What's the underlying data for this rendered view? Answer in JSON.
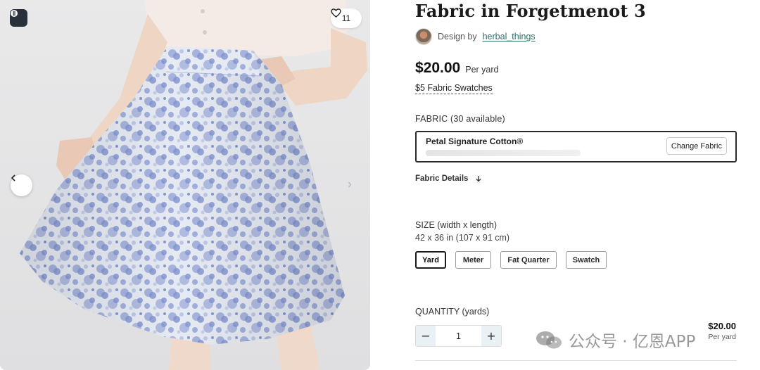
{
  "product": {
    "title": "Fabric in Forgetmenot 3",
    "designer_prefix": "Design by",
    "designer_name": "herbal_things",
    "price": "$20.00",
    "price_unit": "Per yard",
    "swatches_link": "$5 Fabric Swatches"
  },
  "gallery": {
    "favorite_count": "11",
    "icons": [
      "brand-logo-icon",
      "heart-icon",
      "chevron-left-icon",
      "chevron-right-icon"
    ]
  },
  "fabric": {
    "label": "FABRIC (30 available)",
    "selected_name": "Petal Signature Cotton®",
    "change_button": "Change Fabric",
    "details_toggle": "Fabric Details"
  },
  "size": {
    "label": "SIZE (width x length)",
    "dimensions": "42 x 36 in (107 x 91 cm)",
    "options": [
      "Yard",
      "Meter",
      "Fat Quarter",
      "Swatch"
    ],
    "selected": "Yard"
  },
  "quantity": {
    "label": "QUANTITY (yards)",
    "value": "1",
    "decrement": "−",
    "increment": "+",
    "total_price": "$20.00",
    "total_unit": "Per yard"
  },
  "watermark": {
    "text": "公众号 · 亿恩APP"
  },
  "colors": {
    "accent_link": "#2a6f6a",
    "selected_border": "#1c1c1c",
    "stepper_bg": "#e9f1f4",
    "fabric_print": "#8c9fd6"
  }
}
